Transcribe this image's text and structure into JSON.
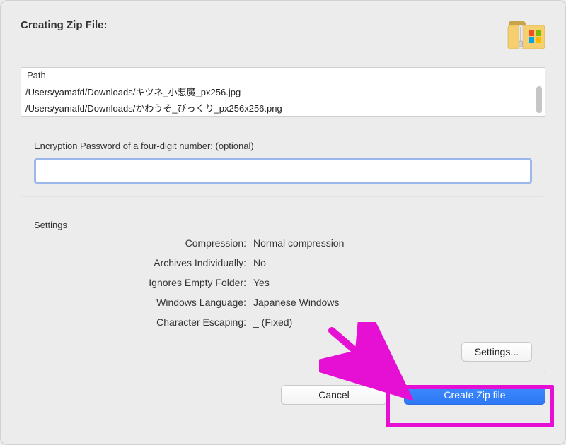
{
  "title": "Creating Zip File:",
  "path_header": "Path",
  "paths": [
    "/Users/yamafd/Downloads/キツネ_小悪魔_px256.jpg",
    "/Users/yamafd/Downloads/かわうそ_びっくり_px256x256.png"
  ],
  "password": {
    "label": "Encryption Password of a four-digit number: (optional)",
    "value": ""
  },
  "settings": {
    "legend": "Settings",
    "rows": [
      {
        "label": "Compression:",
        "value": "Normal compression"
      },
      {
        "label": "Archives Individually:",
        "value": "No"
      },
      {
        "label": "Ignores Empty Folder:",
        "value": "Yes"
      },
      {
        "label": "Windows Language:",
        "value": "Japanese Windows"
      },
      {
        "label": "Character Escaping:",
        "value": "_ (Fixed)"
      }
    ],
    "button": "Settings..."
  },
  "buttons": {
    "cancel": "Cancel",
    "create": "Create Zip file"
  }
}
